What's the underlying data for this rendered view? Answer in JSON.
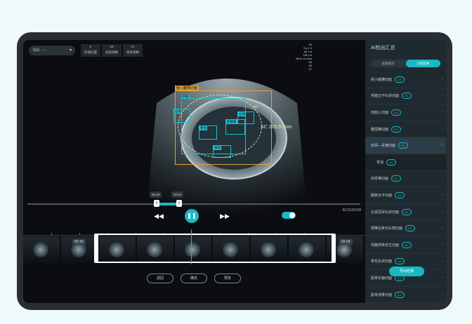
{
  "header": {
    "ga_label": "GA: - -",
    "stats": [
      {
        "value": "2",
        "label": "检测切面"
      },
      {
        "value": "18",
        "label": "总检测数"
      },
      {
        "value": "21",
        "label": "总检测数"
      }
    ],
    "info_lines": [
      "30",
      "TIs 1.4",
      "MI 0.6",
      "TIB 0.6",
      "29Hz 11.4cm",
      "58",
      "56",
      "7C"
    ]
  },
  "overlay": {
    "title": "胎儿腹部切面",
    "labels": [
      "肝脏",
      "左肾",
      "胃泡",
      "脐静脉",
      "脊柱",
      "右肾",
      "AC"
    ],
    "measurement": "AC 205.57mm"
  },
  "playback": {
    "time_left": "02:19",
    "time_right": "02:24",
    "handle_left": "0",
    "handle_right": "0",
    "current_total": "02:21/03:58",
    "prev_icon": "skip-back-icon",
    "play_icon": "pause-icon",
    "next_icon": "skip-forward-icon"
  },
  "timeline": {
    "label_left": "02:19",
    "label_right": "02:24"
  },
  "actions": [
    {
      "label": "返回"
    },
    {
      "label": "确定"
    },
    {
      "label": "预览"
    }
  ],
  "sidebar": {
    "title": "AI检出汇总",
    "tabs": [
      {
        "label": "查看图示"
      },
      {
        "label": "已检结果"
      }
    ],
    "items": [
      {
        "label": "经小脑横切面",
        "badge": "2/4"
      },
      {
        "label": "颅脑正中矢状切面",
        "badge": "2/4"
      },
      {
        "label": "四腔心切面",
        "badge": "2/4"
      },
      {
        "label": "腹围横切面",
        "badge": "2/4"
      },
      {
        "label": "双肾—肾横切面",
        "badge": "2/4",
        "active": true
      },
      {
        "label": "胃泡",
        "badge": "2/4",
        "sub": true
      },
      {
        "label": "双肾横切面",
        "badge": "2/4"
      },
      {
        "label": "膀胱水平切面",
        "badge": "2/4"
      },
      {
        "label": "右肾冠状矢状切面",
        "badge": "2/4"
      },
      {
        "label": "颈椎后骨切头侧切面",
        "badge": "2/4"
      },
      {
        "label": "颅脑颅骨定位切面",
        "badge": "2/4"
      },
      {
        "label": "脊柱矢状切面",
        "badge": "2/4"
      },
      {
        "label": "股骨长轴切面",
        "badge": "2/4"
      },
      {
        "label": "股骨测量切面",
        "badge": "2/4"
      }
    ],
    "export_label": "导出结果"
  },
  "colors": {
    "accent": "#19b9c4",
    "panel": "#1f2a30"
  }
}
